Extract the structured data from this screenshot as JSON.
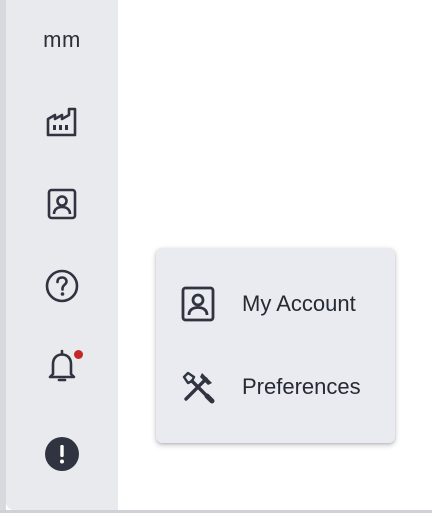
{
  "sidebar": {
    "avatar_initials": "mm",
    "items": [
      {
        "icon": "factory-icon"
      },
      {
        "icon": "account-box-icon"
      },
      {
        "icon": "help-circle-icon"
      },
      {
        "icon": "bell-icon",
        "has_notification": true
      },
      {
        "icon": "alert-circle-icon"
      }
    ]
  },
  "menu": {
    "items": [
      {
        "label": "My Account",
        "icon": "account-box-icon"
      },
      {
        "label": "Preferences",
        "icon": "tools-icon"
      }
    ]
  },
  "colors": {
    "sidebar_bg": "#e9eaee",
    "icon": "#2f3440",
    "menu_bg": "#e9ebf0",
    "notification": "#c62828"
  }
}
